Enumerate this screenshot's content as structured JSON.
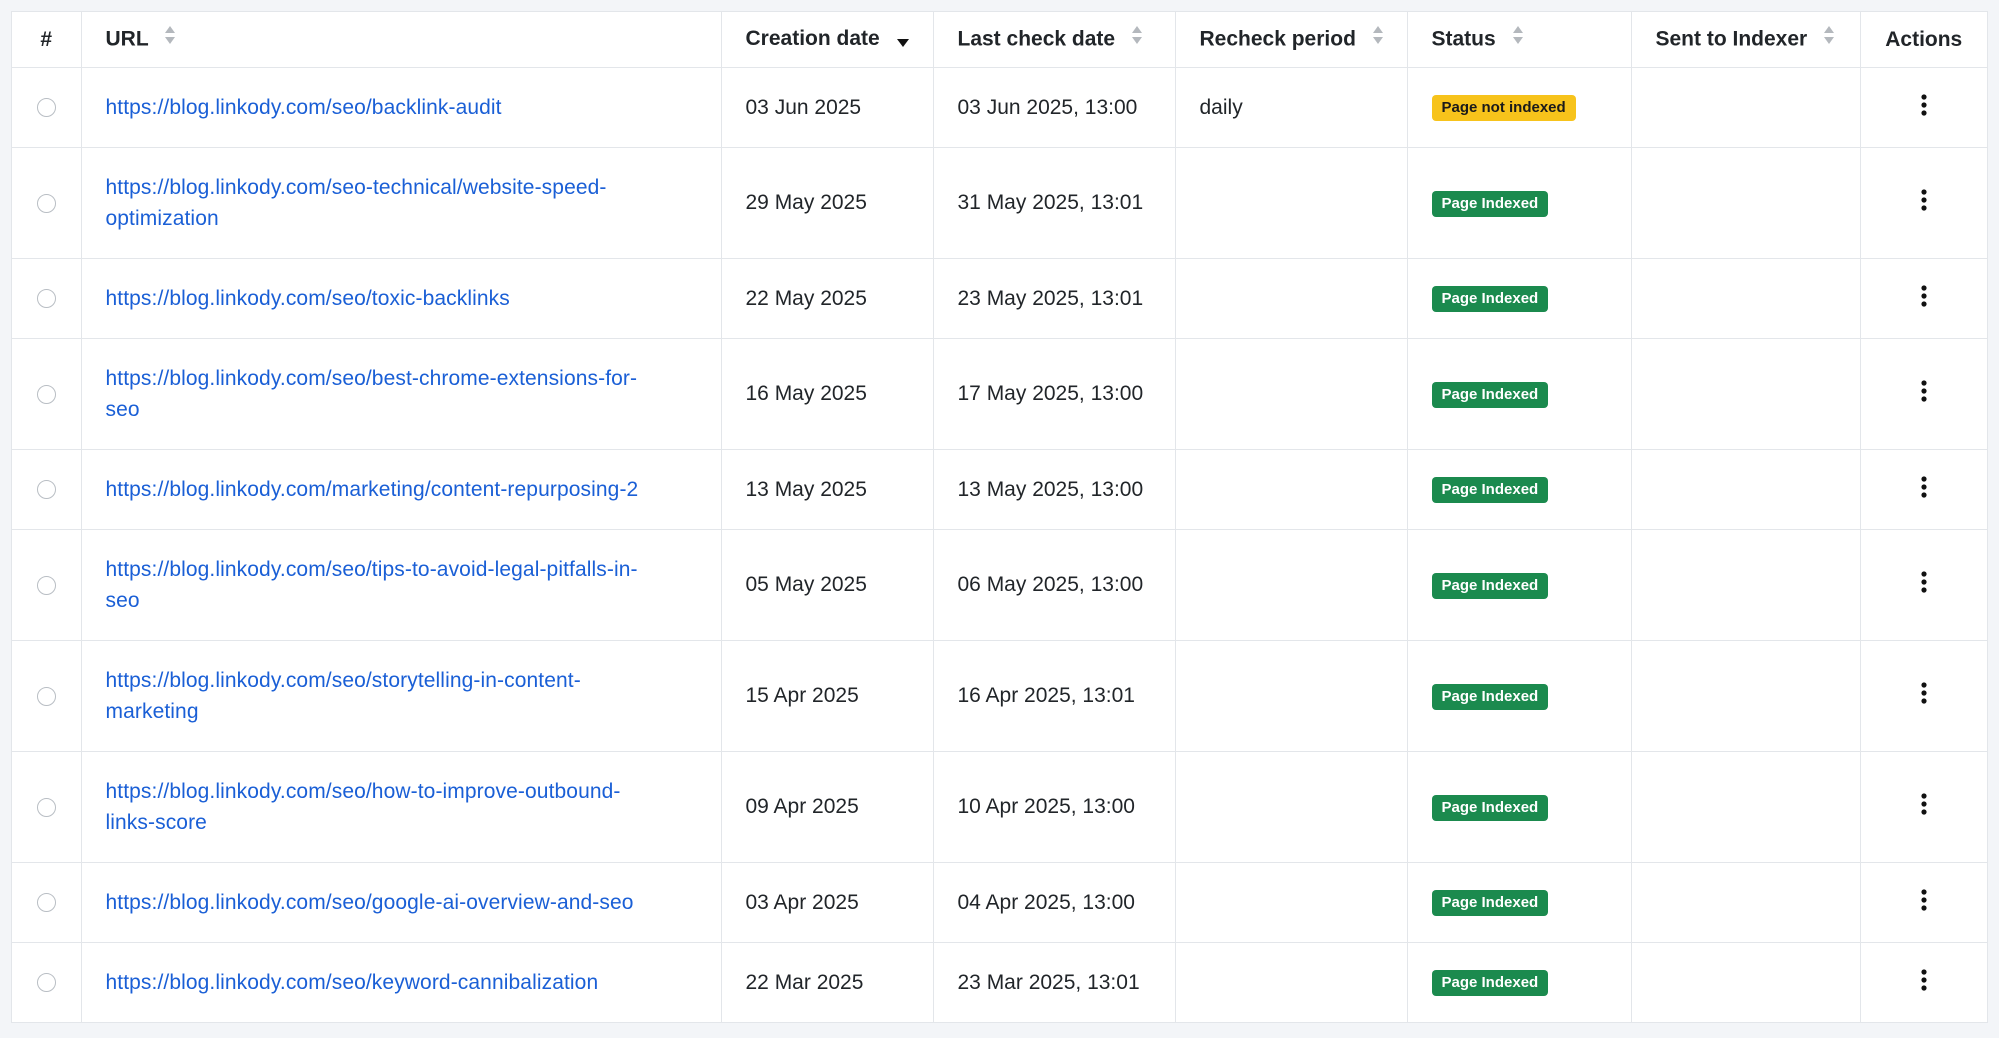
{
  "columns": {
    "num": "#",
    "url": "URL",
    "creation_date": "Creation date",
    "last_check_date": "Last check date",
    "recheck_period": "Recheck period",
    "status": "Status",
    "sent_to_indexer": "Sent to Indexer",
    "actions": "Actions"
  },
  "sort": {
    "column": "creation_date",
    "direction": "desc"
  },
  "status_colors": {
    "Page Indexed": "#1b8a4e",
    "Page not indexed": "#f7c31b"
  },
  "rows": [
    {
      "url_lines": [
        "https://blog.linkody.com/seo/backlink-audit"
      ],
      "creation_date": "03 Jun 2025",
      "last_check_date": "03 Jun 2025, 13:00",
      "recheck_period": "daily",
      "status": "Page not indexed",
      "sent_to_indexer": ""
    },
    {
      "url_lines": [
        "https://blog.linkody.com/seo-technical/website-speed-",
        "optimization"
      ],
      "creation_date": "29 May 2025",
      "last_check_date": "31 May 2025, 13:01",
      "recheck_period": "",
      "status": "Page Indexed",
      "sent_to_indexer": ""
    },
    {
      "url_lines": [
        "https://blog.linkody.com/seo/toxic-backlinks"
      ],
      "creation_date": "22 May 2025",
      "last_check_date": "23 May 2025, 13:01",
      "recheck_period": "",
      "status": "Page Indexed",
      "sent_to_indexer": ""
    },
    {
      "url_lines": [
        "https://blog.linkody.com/seo/best-chrome-extensions-for-",
        "seo"
      ],
      "creation_date": "16 May 2025",
      "last_check_date": "17 May 2025, 13:00",
      "recheck_period": "",
      "status": "Page Indexed",
      "sent_to_indexer": ""
    },
    {
      "url_lines": [
        "https://blog.linkody.com/marketing/content-repurposing-2"
      ],
      "creation_date": "13 May 2025",
      "last_check_date": "13 May 2025, 13:00",
      "recheck_period": "",
      "status": "Page Indexed",
      "sent_to_indexer": ""
    },
    {
      "url_lines": [
        "https://blog.linkody.com/seo/tips-to-avoid-legal-pitfalls-in-",
        "seo"
      ],
      "creation_date": "05 May 2025",
      "last_check_date": "06 May 2025, 13:00",
      "recheck_period": "",
      "status": "Page Indexed",
      "sent_to_indexer": ""
    },
    {
      "url_lines": [
        "https://blog.linkody.com/seo/storytelling-in-content-",
        "marketing"
      ],
      "creation_date": "15 Apr 2025",
      "last_check_date": "16 Apr 2025, 13:01",
      "recheck_period": "",
      "status": "Page Indexed",
      "sent_to_indexer": ""
    },
    {
      "url_lines": [
        "https://blog.linkody.com/seo/how-to-improve-outbound-",
        "links-score"
      ],
      "creation_date": "09 Apr 2025",
      "last_check_date": "10 Apr 2025, 13:00",
      "recheck_period": "",
      "status": "Page Indexed",
      "sent_to_indexer": ""
    },
    {
      "url_lines": [
        "https://blog.linkody.com/seo/google-ai-overview-and-seo"
      ],
      "creation_date": "03 Apr 2025",
      "last_check_date": "04 Apr 2025, 13:00",
      "recheck_period": "",
      "status": "Page Indexed",
      "sent_to_indexer": ""
    },
    {
      "url_lines": [
        "https://blog.linkody.com/seo/keyword-cannibalization"
      ],
      "creation_date": "22 Mar 2025",
      "last_check_date": "23 Mar 2025, 13:01",
      "recheck_period": "",
      "status": "Page Indexed",
      "sent_to_indexer": ""
    }
  ]
}
